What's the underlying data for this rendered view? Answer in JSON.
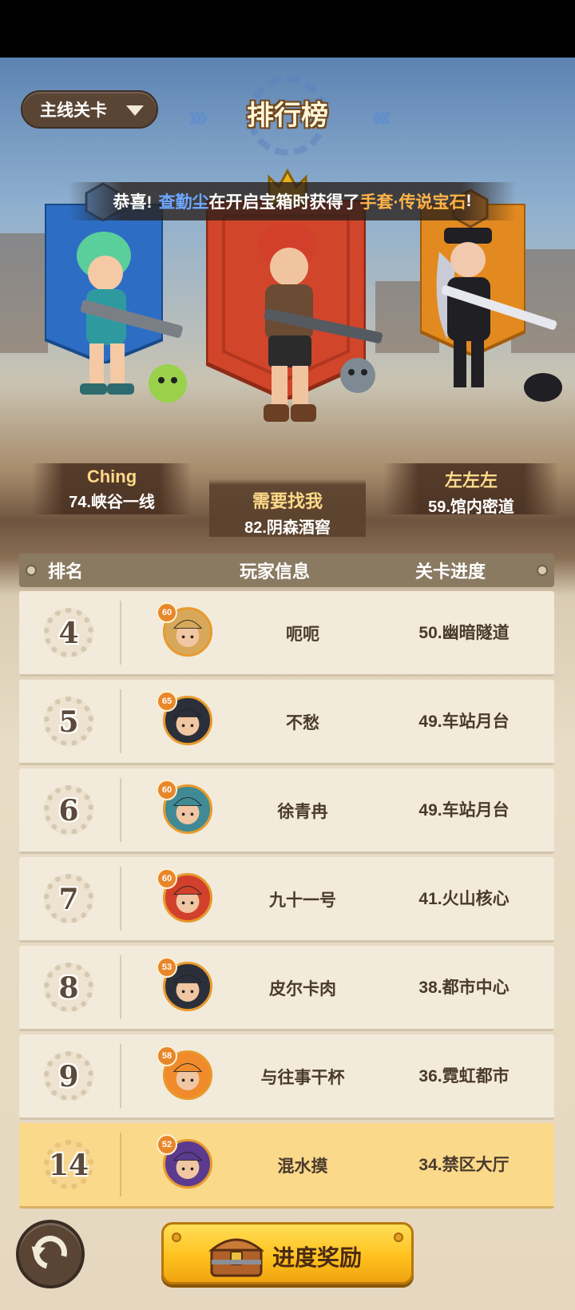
{
  "header": {
    "mode_dropdown": "主线关卡",
    "title": "排行榜"
  },
  "notice": {
    "prefix": "恭喜!",
    "player": "查勤尘",
    "middle": "在开启宝箱时获得了",
    "item": "手套·传说宝石",
    "suffix": "!"
  },
  "podium": [
    {
      "rank": "1",
      "name": "需要找我",
      "stage": "82.阴森酒窖",
      "color": "#c94a2e"
    },
    {
      "rank": "2",
      "name": "Ching",
      "stage": "74.峡谷一线",
      "color": "#2a6fc9"
    },
    {
      "rank": "3",
      "name": "左左左",
      "stage": "59.馆内密道",
      "color": "#e08a1e"
    }
  ],
  "table": {
    "headers": {
      "rank": "排名",
      "player": "玩家信息",
      "progress": "关卡进度"
    },
    "rows": [
      {
        "rank": "4",
        "level": "60",
        "name": "呃呃",
        "stage": "50.幽暗隧道"
      },
      {
        "rank": "5",
        "level": "65",
        "name": "不愁",
        "stage": "49.车站月台"
      },
      {
        "rank": "6",
        "level": "60",
        "name": "徐青冉",
        "stage": "49.车站月台"
      },
      {
        "rank": "7",
        "level": "60",
        "name": "九十一号",
        "stage": "41.火山核心"
      },
      {
        "rank": "8",
        "level": "53",
        "name": "皮尔卡肉",
        "stage": "38.都市中心"
      },
      {
        "rank": "9",
        "level": "58",
        "name": "与往事干杯",
        "stage": "36.霓虹都市"
      },
      {
        "rank": "14",
        "level": "52",
        "name": "混水摸",
        "stage": "34.禁区大厅"
      }
    ]
  },
  "footer": {
    "reward_button": "进度奖励"
  }
}
